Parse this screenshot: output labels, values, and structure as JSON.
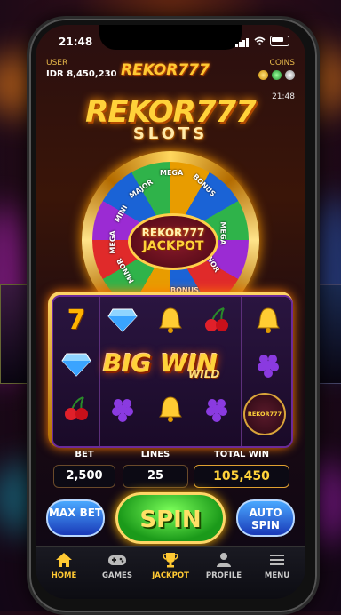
{
  "status": {
    "time": "21:48"
  },
  "header": {
    "user_label": "USER",
    "balance": "IDR 8,450,230",
    "logo": "REKOR777",
    "coins_label": "COINS",
    "time_small": "21:48"
  },
  "title": {
    "main": "REKOR777",
    "sub": "SLOTS"
  },
  "wheel": {
    "segments": [
      "MEGA",
      "BONUS",
      "MEGA",
      "MINI",
      "MAJOR",
      "MINOR",
      "MEGA",
      "MINOR",
      "BONUS"
    ],
    "center_line1": "REKOR777",
    "center_line2": "JACKPOT"
  },
  "reels": {
    "big_win": "BIG WIN",
    "wild": "WILD",
    "badge": "REKOR777"
  },
  "stats": {
    "bet_label": "BET",
    "bet_value": "2,500",
    "lines_label": "LINES",
    "lines_value": "25",
    "total_win_label": "TOTAL WIN",
    "total_win_value": "105,450"
  },
  "controls": {
    "max_bet": "MAX BET",
    "spin": "SPIN",
    "auto_spin": "AUTO SPIN"
  },
  "nav": {
    "items": [
      {
        "label": "HOME",
        "icon": "home-icon"
      },
      {
        "label": "GAMES",
        "icon": "gamepad-icon"
      },
      {
        "label": "JACKPOT",
        "icon": "trophy-icon"
      },
      {
        "label": "PROFILE",
        "icon": "person-icon"
      },
      {
        "label": "MENU",
        "icon": "menu-icon"
      }
    ]
  },
  "colors": {
    "gold": "#ffd23a",
    "spin_green": "#2fb34a",
    "side_blue": "#1a3ab8",
    "active_nav": "#ffc933"
  }
}
